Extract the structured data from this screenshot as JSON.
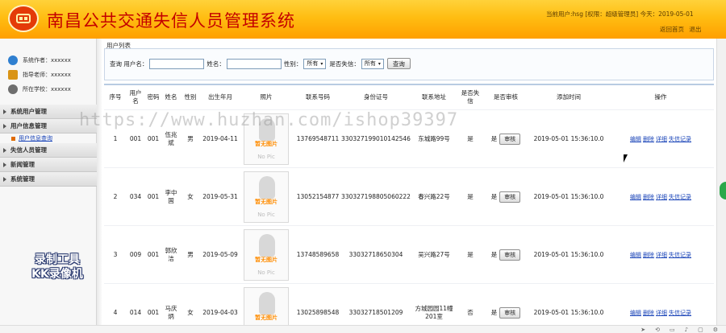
{
  "header": {
    "title": "南昌公共交通失信人员管理系统",
    "user_info": "当前用户:hsg [权限：超级管理员] 今天：2019-05-01",
    "links": [
      "返回首页",
      "退出"
    ]
  },
  "sidebar": {
    "info": [
      {
        "icon": "author-icon",
        "text": "系统作者：xxxxxx"
      },
      {
        "icon": "teacher-icon",
        "text": "指导老师：xxxxxx"
      },
      {
        "icon": "school-icon",
        "text": "所在学校：xxxxxx"
      }
    ],
    "nav": [
      {
        "label": "系统用户管理",
        "sub": []
      },
      {
        "label": "用户信息管理",
        "sub": [
          "用户信息查询"
        ]
      },
      {
        "label": "失信人员管理",
        "sub": []
      },
      {
        "label": "新闻管理",
        "sub": []
      },
      {
        "label": "系统管理",
        "sub": []
      }
    ]
  },
  "main": {
    "panel_title": "用户列表",
    "search": {
      "prefix": "查询",
      "username_label": "用户名：",
      "name_label": "姓名：",
      "gender_label": "性别：",
      "gender_value": "所有",
      "dishonest_label": "是否失信：",
      "dishonest_value": "所有",
      "submit": "查询"
    },
    "columns": [
      "序号",
      "用户名",
      "密码",
      "姓名",
      "性别",
      "出生年月",
      "照片",
      "联系号码",
      "身份证号",
      "联系地址",
      "是否失信",
      "是否审核",
      "添加时间",
      "操作"
    ],
    "photo_placeholder": "暂无图片",
    "photo_placeholder_en": "No Pic",
    "audit_button": "审核",
    "actions": [
      "编辑",
      "删除",
      "详细",
      "失信记录"
    ],
    "rows": [
      {
        "no": "1",
        "username": "001",
        "password": "001",
        "name": "伍兆斌",
        "gender": "男",
        "birth": "2019-04-11",
        "phone": "13769548711",
        "id_card": "330327199010142546",
        "address": "东城路99号",
        "dishonest": "是",
        "audited": "是",
        "added": "2019-05-01 15:36:10.0"
      },
      {
        "no": "2",
        "username": "034",
        "password": "001",
        "name": "李中国",
        "gender": "女",
        "birth": "2019-05-31",
        "phone": "13052154877",
        "id_card": "330327198805060222",
        "address": "春兴路22号",
        "dishonest": "是",
        "audited": "是",
        "added": "2019-05-01 15:36:10.0"
      },
      {
        "no": "3",
        "username": "009",
        "password": "001",
        "name": "郭欣洁",
        "gender": "男",
        "birth": "2019-05-09",
        "phone": "13748589658",
        "id_card": "33032718650304",
        "address": "吴兴路27号",
        "dishonest": "是",
        "audited": "是",
        "added": "2019-05-01 15:36:10.0"
      },
      {
        "no": "4",
        "username": "014",
        "password": "001",
        "name": "马庆炳",
        "gender": "女",
        "birth": "2019-04-03",
        "phone": "13025898548",
        "id_card": "33032718501209",
        "address": "方城园园11幢201室",
        "dishonest": "否",
        "audited": "是",
        "added": "2019-05-01 15:36:10.0"
      }
    ]
  },
  "overlays": {
    "watermark_url": "https://www.huzhan.com/ishop39397",
    "recorder_line1": "录制工具",
    "recorder_line2": "KK录像机"
  }
}
